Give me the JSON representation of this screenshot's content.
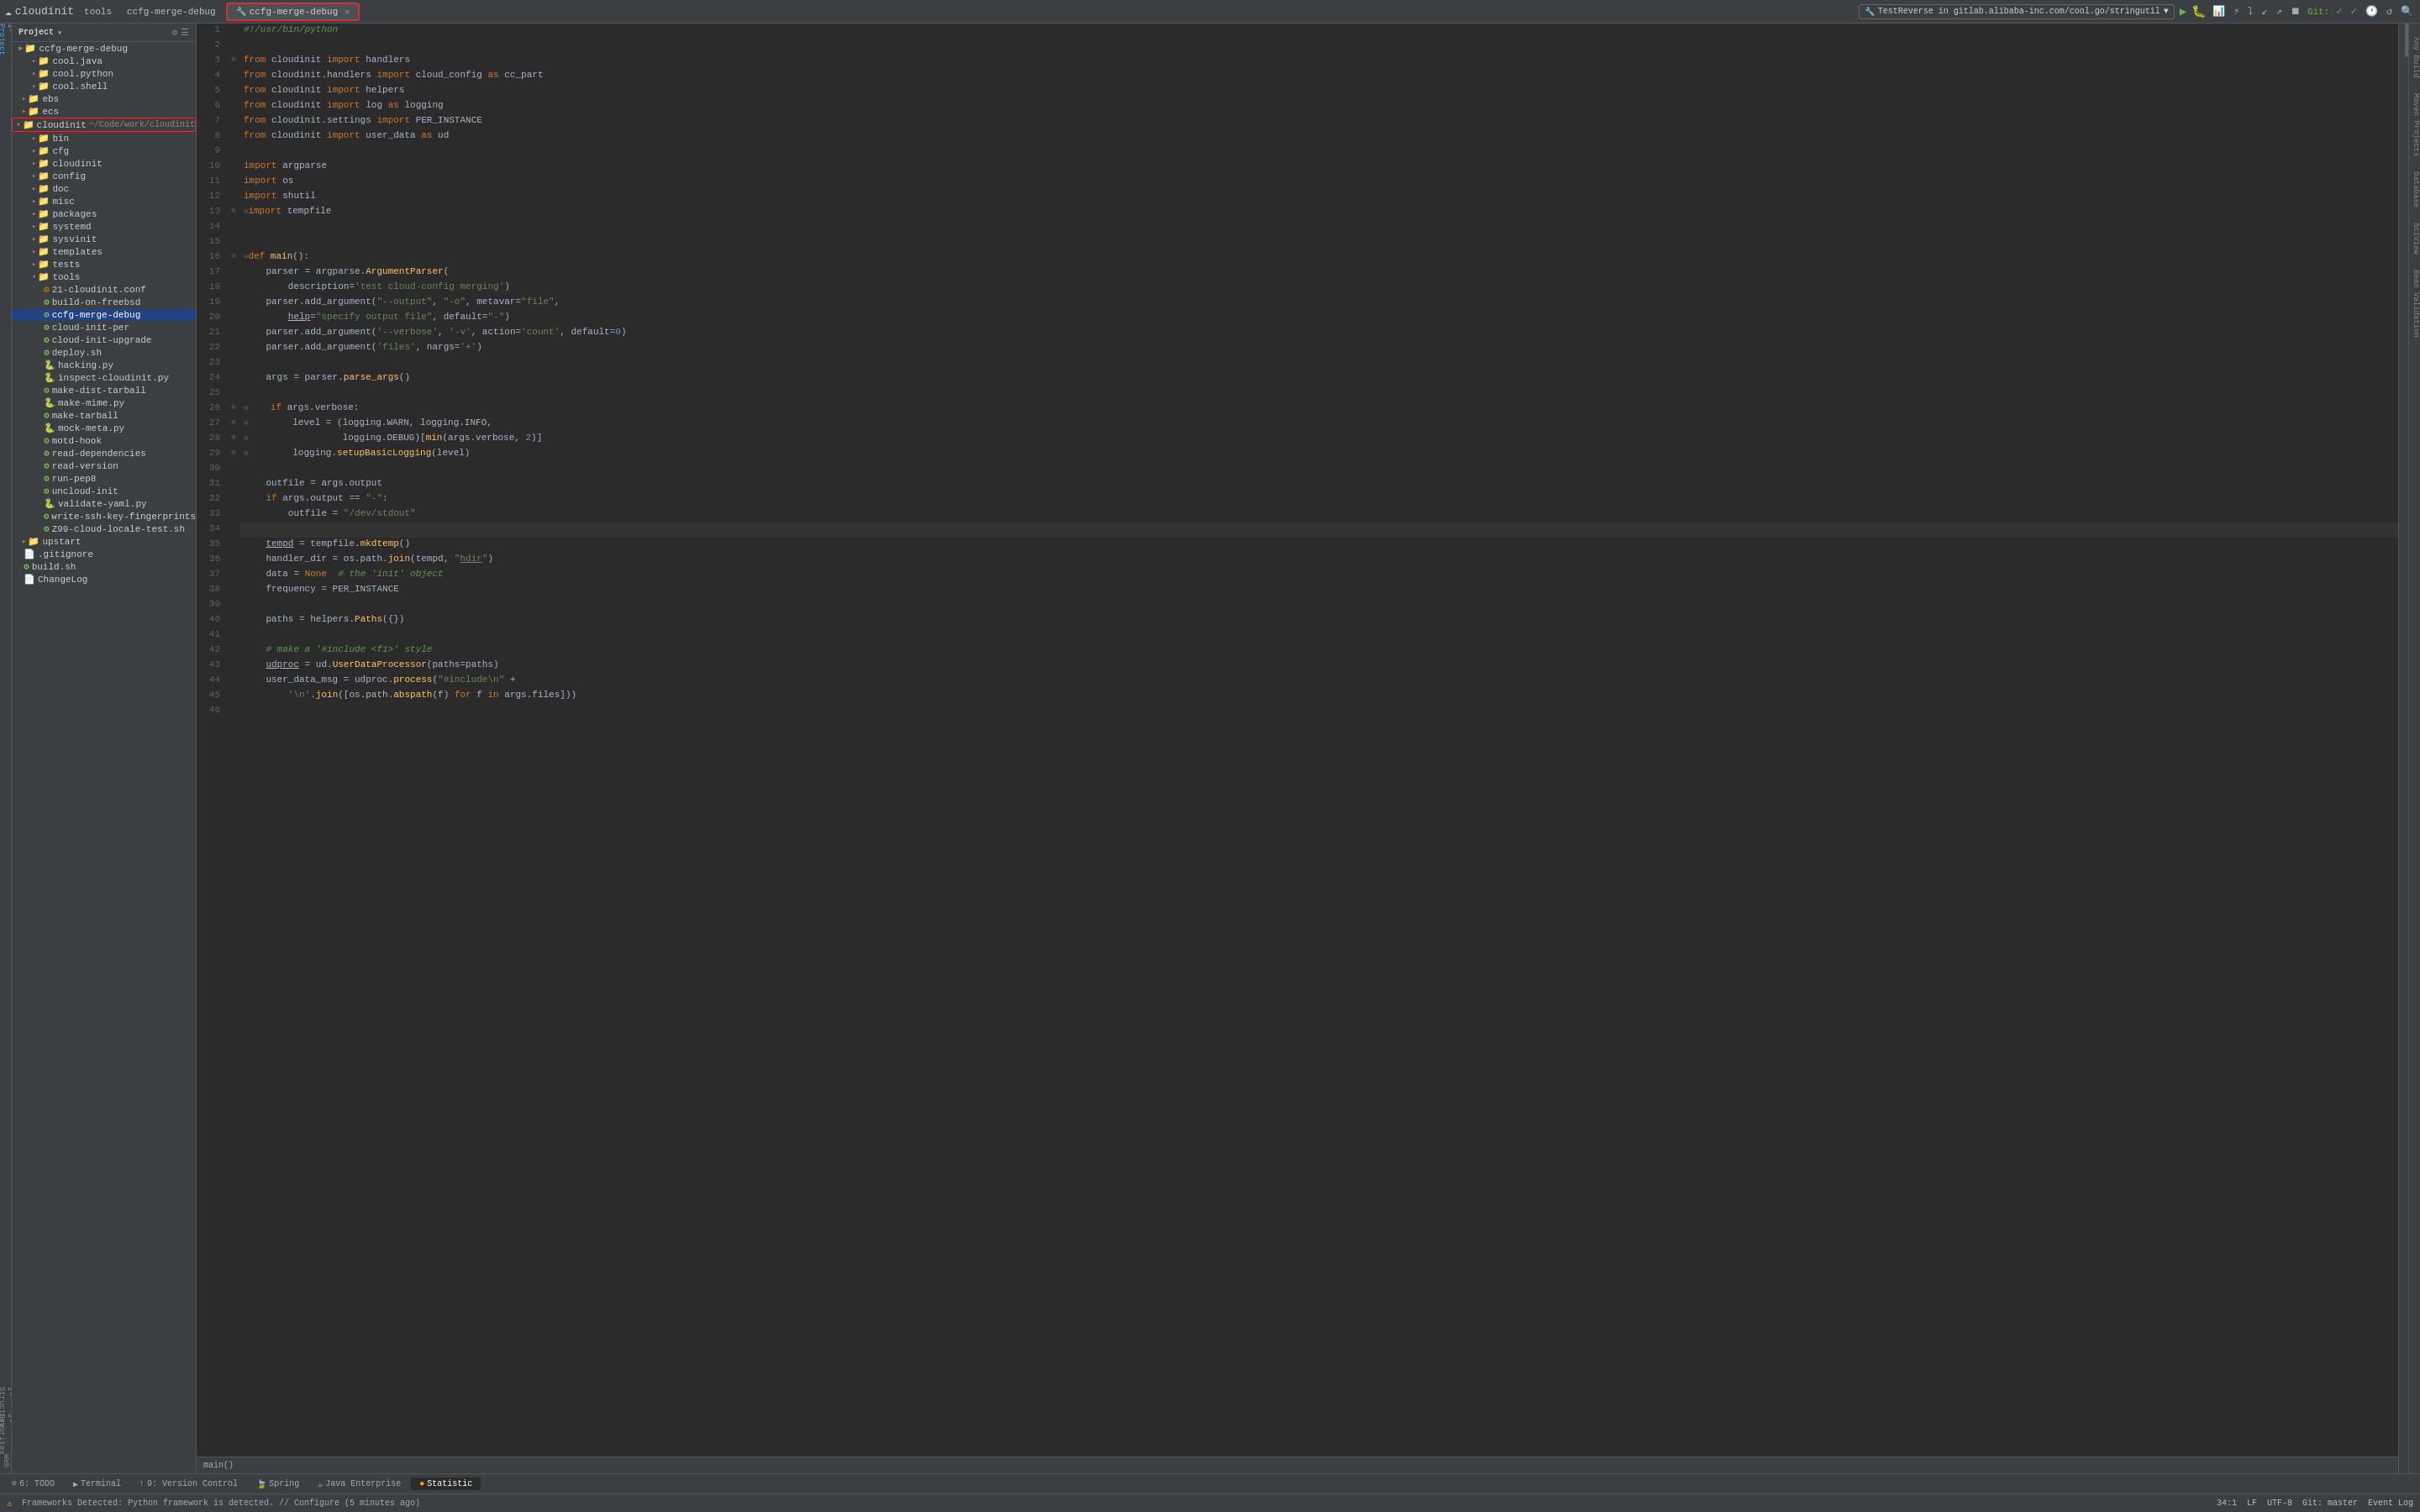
{
  "app": {
    "name": "cloudinit",
    "icon": "☁"
  },
  "top_nav": [
    "tools",
    "ccfg-merge-debug"
  ],
  "editor_tab": {
    "label": "ccfg-merge-debug",
    "icon": "🔧",
    "active": true
  },
  "run_config": {
    "label": "TestReverse in gitlab.alibaba-inc.com/cool.go/stringutil"
  },
  "git": {
    "status": "Git: master"
  },
  "sidebar": {
    "title": "Project",
    "project_name": "ccfg-merge-debug",
    "items": [
      {
        "label": "cool.java",
        "type": "folder",
        "indent": 2,
        "expanded": false
      },
      {
        "label": "cool.python",
        "type": "folder",
        "indent": 2,
        "expanded": false
      },
      {
        "label": "cool.shell",
        "type": "folder",
        "indent": 2,
        "expanded": false
      },
      {
        "label": "ebs",
        "type": "folder",
        "indent": 1,
        "expanded": false
      },
      {
        "label": "ecs",
        "type": "folder",
        "indent": 1,
        "expanded": false
      },
      {
        "label": "cloudinit",
        "sublabel": "~/Code/work/cloudinit",
        "type": "folder",
        "indent": 1,
        "expanded": true,
        "active": true
      },
      {
        "label": "bin",
        "type": "folder",
        "indent": 2,
        "expanded": false
      },
      {
        "label": "cfg",
        "type": "folder",
        "indent": 2,
        "expanded": false
      },
      {
        "label": "cloudinit",
        "type": "folder",
        "indent": 2,
        "expanded": false
      },
      {
        "label": "config",
        "type": "folder",
        "indent": 2,
        "expanded": false
      },
      {
        "label": "doc",
        "type": "folder",
        "indent": 2,
        "expanded": false
      },
      {
        "label": "misc",
        "type": "folder",
        "indent": 2,
        "expanded": false
      },
      {
        "label": "packages",
        "type": "folder",
        "indent": 2,
        "expanded": false
      },
      {
        "label": "systemd",
        "type": "folder",
        "indent": 2,
        "expanded": false
      },
      {
        "label": "sysvinit",
        "type": "folder",
        "indent": 2,
        "expanded": false
      },
      {
        "label": "templates",
        "type": "folder",
        "indent": 2,
        "expanded": false
      },
      {
        "label": "tests",
        "type": "folder",
        "indent": 2,
        "expanded": false
      },
      {
        "label": "tools",
        "type": "folder",
        "indent": 2,
        "expanded": true
      },
      {
        "label": "21-cloudinit.conf",
        "type": "file_cfg",
        "indent": 3
      },
      {
        "label": "build-on-freebsd",
        "type": "file_sh",
        "indent": 3
      },
      {
        "label": "ccfg-merge-debug",
        "type": "file_sh",
        "indent": 3,
        "selected": true
      },
      {
        "label": "cloud-init-per",
        "type": "file_sh",
        "indent": 3
      },
      {
        "label": "cloud-init-upgrade",
        "type": "file_sh",
        "indent": 3
      },
      {
        "label": "deploy.sh",
        "type": "file_sh",
        "indent": 3
      },
      {
        "label": "hacking.py",
        "type": "file_py",
        "indent": 3
      },
      {
        "label": "inspect-cloudinit.py",
        "type": "file_py",
        "indent": 3
      },
      {
        "label": "make-dist-tarball",
        "type": "file_sh",
        "indent": 3
      },
      {
        "label": "make-mime.py",
        "type": "file_py",
        "indent": 3
      },
      {
        "label": "make-tarball",
        "type": "file_sh",
        "indent": 3
      },
      {
        "label": "mock-meta.py",
        "type": "file_py",
        "indent": 3
      },
      {
        "label": "motd-hook",
        "type": "file_sh",
        "indent": 3
      },
      {
        "label": "read-dependencies",
        "type": "file_sh",
        "indent": 3
      },
      {
        "label": "read-version",
        "type": "file_sh",
        "indent": 3
      },
      {
        "label": "run-pep8",
        "type": "file_sh",
        "indent": 3
      },
      {
        "label": "uncloud-init",
        "type": "file_sh",
        "indent": 3
      },
      {
        "label": "validate-yaml.py",
        "type": "file_py",
        "indent": 3
      },
      {
        "label": "write-ssh-key-fingerprints",
        "type": "file_sh",
        "indent": 3
      },
      {
        "label": "Z99-cloud-locale-test.sh",
        "type": "file_sh",
        "indent": 3
      },
      {
        "label": "upstart",
        "type": "folder",
        "indent": 1,
        "expanded": false
      },
      {
        "label": ".gitignore",
        "type": "file_text",
        "indent": 1
      },
      {
        "label": "build.sh",
        "type": "file_sh",
        "indent": 1
      },
      {
        "label": "ChangeLog",
        "type": "file_text",
        "indent": 1
      }
    ]
  },
  "code_lines": [
    {
      "num": 1,
      "content_html": "<span class='cm'>#!/usr/bin/python</span>",
      "fold": false,
      "break": false
    },
    {
      "num": 2,
      "content_html": "",
      "fold": false,
      "break": false
    },
    {
      "num": 3,
      "content_html": "<span class='kw'>from</span> cloudinit <span class='kw'>import</span> handlers",
      "fold": true,
      "break": false
    },
    {
      "num": 4,
      "content_html": "<span class='kw'>from</span> cloudinit.handlers <span class='kw'>import</span> cloud_config <span class='kw'>as</span> cc_part",
      "fold": false,
      "break": false
    },
    {
      "num": 5,
      "content_html": "<span class='kw'>from</span> cloudinit <span class='kw'>import</span> helpers",
      "fold": false,
      "break": false
    },
    {
      "num": 6,
      "content_html": "<span class='kw'>from</span> cloudinit <span class='kw'>import</span> log <span class='kw'>as</span> logging",
      "fold": false,
      "break": false
    },
    {
      "num": 7,
      "content_html": "<span class='kw'>from</span> cloudinit.settings <span class='kw'>import</span> PER_INSTANCE",
      "fold": false,
      "break": false
    },
    {
      "num": 8,
      "content_html": "<span class='kw'>from</span> cloudinit <span class='kw'>import</span> user_data <span class='kw'>as</span> ud",
      "fold": false,
      "break": false
    },
    {
      "num": 9,
      "content_html": "",
      "fold": false,
      "break": false
    },
    {
      "num": 10,
      "content_html": "<span class='kw'>import</span> argparse",
      "fold": false,
      "break": false
    },
    {
      "num": 11,
      "content_html": "<span class='kw'>import</span> os",
      "fold": false,
      "break": false
    },
    {
      "num": 12,
      "content_html": "<span class='kw'>import</span> shutil",
      "fold": false,
      "break": false
    },
    {
      "num": 13,
      "content_html": "<span class='fold-marker'>⊖</span><span class='kw'>import</span> tempfile",
      "fold": true,
      "break": false
    },
    {
      "num": 14,
      "content_html": "",
      "fold": false,
      "break": false
    },
    {
      "num": 15,
      "content_html": "",
      "fold": false,
      "break": false
    },
    {
      "num": 16,
      "content_html": "<span class='fold-marker'>⊖</span><span class='kw'>def</span> <span class='fn'>main</span>():",
      "fold": true,
      "break": false
    },
    {
      "num": 17,
      "content_html": "    parser = argparse.<span class='fn'>ArgumentParser</span>(",
      "fold": false,
      "break": false
    },
    {
      "num": 18,
      "content_html": "        description=<span class='str'>'test cloud-config merging'</span>)",
      "fold": false,
      "break": false
    },
    {
      "num": 19,
      "content_html": "    parser.add_argument(<span class='str'>\"--output\"</span>, <span class='str'>\"-o\"</span>, metavar=<span class='str'>\"file\"</span>,",
      "fold": false,
      "break": false
    },
    {
      "num": 20,
      "content_html": "        <span class='under'>help</span>=<span class='str'>\"specify output file\"</span>, default=<span class='str'>\"-\"</span>)",
      "fold": false,
      "break": false
    },
    {
      "num": 21,
      "content_html": "    parser.add_argument(<span class='str'>'--verbose'</span>, <span class='str'>'-v'</span>, action=<span class='str'>'count'</span>, default=<span class='num'>0</span>)",
      "fold": false,
      "break": false
    },
    {
      "num": 22,
      "content_html": "    parser.add_argument(<span class='str'>'files'</span>, nargs=<span class='str'>'+'</span>)",
      "fold": false,
      "break": false
    },
    {
      "num": 23,
      "content_html": "",
      "fold": false,
      "break": false
    },
    {
      "num": 24,
      "content_html": "    args = parser.<span class='fn'>parse_args</span>()",
      "fold": false,
      "break": false
    },
    {
      "num": 25,
      "content_html": "",
      "fold": false,
      "break": false
    },
    {
      "num": 26,
      "content_html": "<span class='fold-marker'>⊖</span>    <span class='kw'>if</span> args.verbose:",
      "fold": true,
      "break": false
    },
    {
      "num": 27,
      "content_html": "<span class='fold-marker'>⊖</span>        level = (logging.WARN, logging.INFO,",
      "fold": true,
      "break": false
    },
    {
      "num": 28,
      "content_html": "<span class='fold-marker'>⊖</span>                 logging.DEBUG)[<span class='fn'>min</span>(args.verbose, <span class='num'>2</span>)]",
      "fold": true,
      "break": false
    },
    {
      "num": 29,
      "content_html": "<span class='fold-marker'>⊖</span>        logging.<span class='fn'>setupBasicLogging</span>(level)",
      "fold": true,
      "break": false
    },
    {
      "num": 30,
      "content_html": "",
      "fold": false,
      "break": false
    },
    {
      "num": 31,
      "content_html": "    outfile = args.output",
      "fold": false,
      "break": false
    },
    {
      "num": 32,
      "content_html": "    <span class='kw'>if</span> args.output == <span class='str'>\"-\"</span>:",
      "fold": false,
      "break": false
    },
    {
      "num": 33,
      "content_html": "        outfile = <span class='str'>\"/dev/stdout\"</span>",
      "fold": false,
      "break": false
    },
    {
      "num": 34,
      "content_html": "",
      "fold": false,
      "break": false,
      "current": true
    },
    {
      "num": 35,
      "content_html": "    <span class='under'>tempd</span> = tempfile.<span class='fn'>mkdtemp</span>()",
      "fold": false,
      "break": false
    },
    {
      "num": 36,
      "content_html": "    handler_dir = os.path.<span class='fn'>join</span>(tempd, <span class='str'>\"<span class='under'>hdir</span>\"</span>)",
      "fold": false,
      "break": false
    },
    {
      "num": 37,
      "content_html": "    data = <span class='none-kw'>None</span>  <span class='cm'># the 'init' object</span>",
      "fold": false,
      "break": false
    },
    {
      "num": 38,
      "content_html": "    frequency = PER_INSTANCE",
      "fold": false,
      "break": false
    },
    {
      "num": 39,
      "content_html": "",
      "fold": false,
      "break": false
    },
    {
      "num": 40,
      "content_html": "    paths = helpers.<span class='fn'>Paths</span>({})",
      "fold": false,
      "break": false
    },
    {
      "num": 41,
      "content_html": "",
      "fold": false,
      "break": false
    },
    {
      "num": 42,
      "content_html": "    <span class='cm'># make a '#include &lt;f1&gt;' style</span>",
      "fold": false,
      "break": false
    },
    {
      "num": 43,
      "content_html": "    <span class='under'>udproc</span> = ud.<span class='fn'>UserDataProcessor</span>(paths=paths)",
      "fold": false,
      "break": false
    },
    {
      "num": 44,
      "content_html": "    user_data_msg = udproc.<span class='fn'>process</span>(<span class='str'>\"#include\\n\"</span> +",
      "fold": false,
      "break": false
    },
    {
      "num": 45,
      "content_html": "        <span class='str'>'\\n'</span>.<span class='fn'>join</span>([os.path.<span class='fn'>abspath</span>(f) <span class='kw'>for</span> f <span class='kw'>in</span> args.files]))",
      "fold": false,
      "break": false
    },
    {
      "num": 46,
      "content_html": "",
      "fold": false,
      "break": false
    }
  ],
  "bottom_tabs": [
    {
      "label": "6: TODO",
      "icon": "≡",
      "active": false
    },
    {
      "label": "Terminal",
      "icon": "▶",
      "active": false
    },
    {
      "label": "9: Version Control",
      "icon": "↑",
      "active": false
    },
    {
      "label": "Spring",
      "icon": "🍃",
      "active": false
    },
    {
      "label": "Java Enterprise",
      "icon": "☕",
      "active": false
    },
    {
      "label": "Statistic",
      "icon": "●",
      "active": true,
      "badge_color": "orange"
    }
  ],
  "status_bar": {
    "cursor": "34:1",
    "lf": "LF",
    "encoding": "UTF-8",
    "git": "Git: master",
    "warning": "Frameworks Detected: Python framework is detected. // Configure (5 minutes ago)",
    "event_log": "Event Log"
  },
  "right_tabs": [
    "Any Build",
    "Maven Projects",
    "Database",
    "SciView",
    "Bean Validation"
  ],
  "main_status": "main()"
}
